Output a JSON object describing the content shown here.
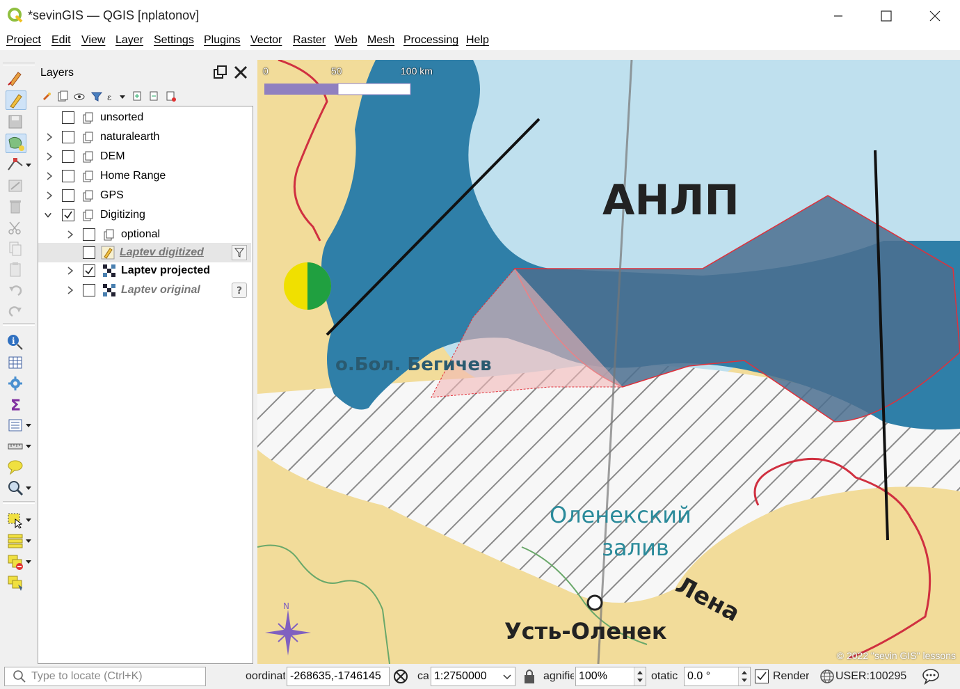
{
  "window": {
    "title": "*sevinGIS — QGIS [nplatonov]"
  },
  "menu": [
    "Project",
    "Edit",
    "View",
    "Layer",
    "Settings",
    "Plugins",
    "Vector",
    "Raster",
    "Web",
    "Mesh",
    "Processing",
    "Help"
  ],
  "layers_panel": {
    "title": "Layers",
    "items": [
      {
        "label": "unsorted",
        "checked": false,
        "expandable": false
      },
      {
        "label": "naturalearth",
        "checked": false,
        "expandable": true
      },
      {
        "label": "DEM",
        "checked": false,
        "expandable": true
      },
      {
        "label": "Home Range",
        "checked": false,
        "expandable": true
      },
      {
        "label": "GPS",
        "checked": false,
        "expandable": true
      },
      {
        "label": "Digitizing",
        "checked": true,
        "expandable": true,
        "expanded": true
      },
      {
        "label": "optional",
        "checked": false,
        "expandable": true
      },
      {
        "label": "Laptev digitized",
        "checked": false,
        "expandable": false
      },
      {
        "label": "Laptev projected",
        "checked": true,
        "expandable": true
      },
      {
        "label": "Laptev original",
        "checked": false,
        "expandable": true
      }
    ]
  },
  "map": {
    "scalebar": {
      "zero": "0",
      "mid": "50",
      "end": "100 km"
    },
    "labels": {
      "sea_code": "АНЛП",
      "island": "о.Бол. Бегичев",
      "gulf_1": "Оленекский",
      "gulf_2": "залив",
      "river": "Лена",
      "town": "Усть-Оленек"
    },
    "north_letter": "N",
    "copyright": "© 2022 \"sevin GIS\" lessons",
    "colors": {
      "sea": "#2f7fa8",
      "light_sea": "#bfe0ee",
      "land": "#f2dc9a",
      "polygon_fill": "#4b6f8f",
      "polygon_stroke": "#e0303a"
    }
  },
  "statusbar": {
    "locate_placeholder": "Type to locate (Ctrl+K)",
    "coord_label": "oordinat",
    "coord_value": "-268635,-1746145",
    "scale_label": "ca",
    "scale_value": "1:2750000",
    "magnifier_label": "agnifie",
    "magnifier_value": "100%",
    "rotation_label": "otatic",
    "rotation_value": "0.0 °",
    "render_label": "Render",
    "crs_label": "USER:100295"
  }
}
